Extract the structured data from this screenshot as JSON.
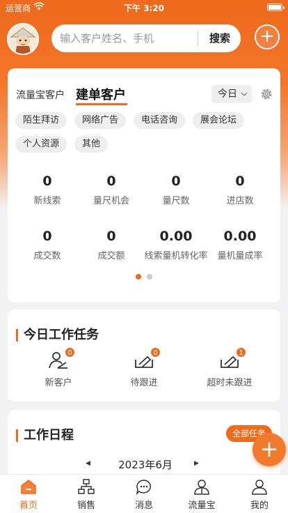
{
  "status_bar": {
    "carrier": "运营商",
    "time": "下午 3:20"
  },
  "header": {
    "search_placeholder": "输入客户姓名、手机",
    "search_button": "搜索"
  },
  "stats": {
    "tabs": [
      "流量宝客户",
      "建单客户"
    ],
    "active_tab": "建单客户",
    "date_filter": "今日",
    "tags": [
      "陌生拜访",
      "网络广告",
      "电话咨询",
      "展会论坛",
      "个人资源",
      "其他"
    ],
    "items": [
      {
        "value": "0",
        "label": "新线索"
      },
      {
        "value": "0",
        "label": "量尺机会"
      },
      {
        "value": "0",
        "label": "量尺数"
      },
      {
        "value": "0",
        "label": "进店数"
      },
      {
        "value": "0",
        "label": "成交数"
      },
      {
        "value": "0",
        "label": "成交额"
      },
      {
        "value": "0.00",
        "label": "线索量机转化率"
      },
      {
        "value": "0.00",
        "label": "量机量成率"
      }
    ],
    "page_index": 0,
    "page_count": 2
  },
  "tasks": {
    "title": "今日工作任务",
    "items": [
      {
        "label": "新客户",
        "count": "0",
        "icon": "new-customer-icon"
      },
      {
        "label": "待跟进",
        "count": "0",
        "icon": "follow-up-icon"
      },
      {
        "label": "超时未跟进",
        "count": "1",
        "icon": "overdue-icon"
      }
    ]
  },
  "schedule": {
    "title": "工作日程",
    "all_tasks": "全部任务",
    "month": "2023年6月"
  },
  "bottom_nav": [
    {
      "label": "首页",
      "icon": "home-icon",
      "active": true
    },
    {
      "label": "销售",
      "icon": "sales-icon",
      "active": false
    },
    {
      "label": "消息",
      "icon": "message-icon",
      "active": false
    },
    {
      "label": "流量宝",
      "icon": "traffic-icon",
      "active": false
    },
    {
      "label": "我的",
      "icon": "profile-icon",
      "active": false
    }
  ],
  "colors": {
    "accent": "#ee6a1c",
    "background": "#f2f2f4"
  }
}
